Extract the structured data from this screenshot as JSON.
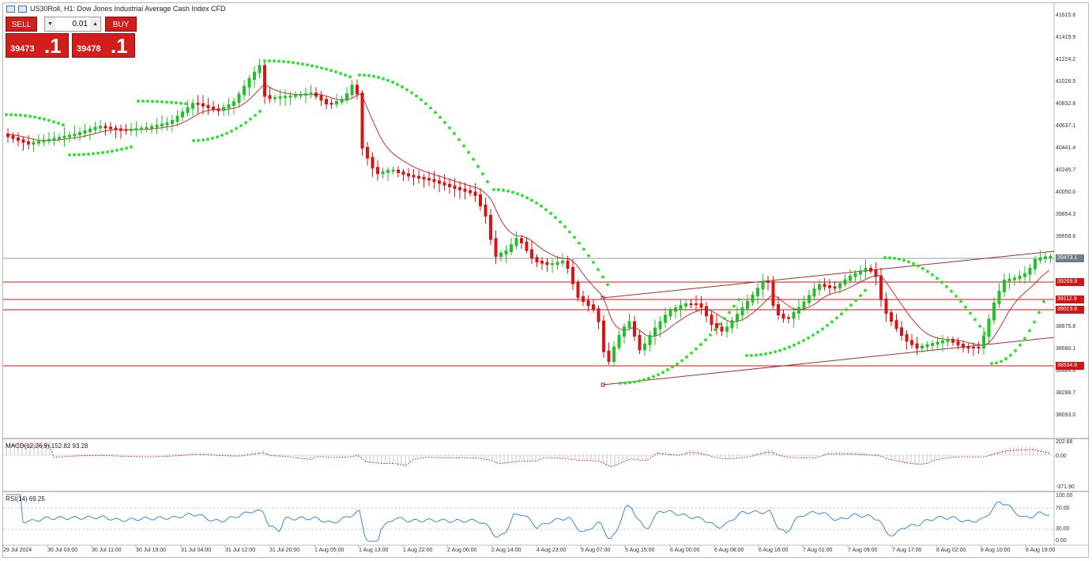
{
  "title": {
    "text": "US30Roll, H1:  Dow Jones Industrial Average Cash Index CFD"
  },
  "trade_panel": {
    "sell_label": "SELL",
    "buy_label": "BUY",
    "lot_value": "0.01",
    "sell_price_small": "39473",
    "sell_price_big": ".1",
    "buy_price_small": "39478",
    "buy_price_big": ".1",
    "down_arrow": "▼",
    "up_arrow": "▲"
  },
  "price_axis": {
    "ticks": [
      "41615.6",
      "41419.9",
      "41224.2",
      "41028.5",
      "40832.8",
      "40637.1",
      "40441.4",
      "40245.7",
      "40050.0",
      "39854.3",
      "39658.6",
      "38875.8",
      "38680.1",
      "38484.4",
      "38288.7",
      "38093.0"
    ],
    "current_price_label": "39473.1",
    "hline_labels": [
      "39269.9",
      "39112.9",
      "39019.6",
      "38534.8"
    ],
    "current_price_color": "#6d7d8b",
    "hline_color": "#d01515"
  },
  "macd": {
    "label": "MACD(12,26,9) 152.82 93.28",
    "ticks": [
      "202.68",
      "0.00",
      "-371.90"
    ]
  },
  "rsi": {
    "label": "RSI(14) 69.25",
    "ticks": [
      "100.00",
      "70.00",
      "30.00",
      "0.00"
    ]
  },
  "time_axis": {
    "labels": [
      "29 Jul 2024",
      "30 Jul 03:00",
      "30 Jul 11:00",
      "30 Jul 19:00",
      "31 Jul 04:00",
      "31 Jul 12:00",
      "31 Jul 20:00",
      "1 Aug 05:00",
      "1 Aug 13:00",
      "1 Aug 22:00",
      "2 Aug 06:00",
      "2 Aug 14:00",
      "4 Aug 23:00",
      "5 Aug 07:00",
      "5 Aug 15:00",
      "6 Aug 00:00",
      "6 Aug 08:00",
      "6 Aug 16:00",
      "7 Aug 01:00",
      "7 Aug 09:00",
      "7 Aug 17:00",
      "8 Aug 02:00",
      "8 Aug 10:00",
      "8 Aug 19:00"
    ]
  },
  "colors": {
    "bull": "#22c02a",
    "bear": "#d81414",
    "sar": "#19e819",
    "ma": "#c03030",
    "rsi_line": "#3a8ad0",
    "channel": "#a03030"
  }
}
